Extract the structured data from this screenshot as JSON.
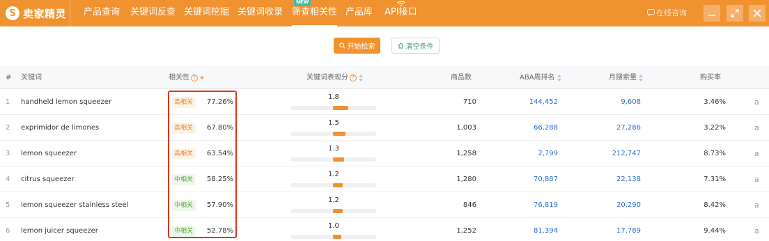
{
  "app": {
    "logo_mark": "S",
    "logo_text": "卖家精灵"
  },
  "nav": {
    "items": [
      "产品查询",
      "关键词反查",
      "关键词挖掘",
      "关键词收录",
      "筛查相关性",
      "产品库",
      "API接口"
    ],
    "active_index": 4,
    "badge": "NEW",
    "consult_label": "在线咨询"
  },
  "toolbar": {
    "search_label": "开始检索",
    "clear_label": "清空条件"
  },
  "table": {
    "columns": {
      "index": "#",
      "keyword": "关键词",
      "relevance": "相关性",
      "performance": "关键词表现分",
      "products": "商品数",
      "aba_rank": "ABA周排名",
      "monthly_searches": "月搜索量",
      "purchase_rate": "购买率"
    },
    "rows": [
      {
        "idx": "1",
        "keyword": "handheld lemon squeezer",
        "tag": "高相关",
        "level": "high",
        "relevance_pct": "77.26%",
        "score": "1.8",
        "products": "710",
        "aba_rank": "144,452",
        "monthly_searches": "9,608",
        "purchase_rate": "3.46%",
        "amazon_icon": "a"
      },
      {
        "idx": "2",
        "keyword": "exprimidor de limones",
        "tag": "高相关",
        "level": "high",
        "relevance_pct": "67.80%",
        "score": "1.5",
        "products": "1,003",
        "aba_rank": "66,288",
        "monthly_searches": "27,286",
        "purchase_rate": "3.22%",
        "amazon_icon": "a"
      },
      {
        "idx": "3",
        "keyword": "lemon squeezer",
        "tag": "高相关",
        "level": "high",
        "relevance_pct": "63.54%",
        "score": "1.3",
        "products": "1,258",
        "aba_rank": "2,799",
        "monthly_searches": "212,747",
        "purchase_rate": "8.73%",
        "amazon_icon": "a"
      },
      {
        "idx": "4",
        "keyword": "citrus squeezer",
        "tag": "中相关",
        "level": "mid",
        "relevance_pct": "58.25%",
        "score": "1.2",
        "products": "1,280",
        "aba_rank": "70,887",
        "monthly_searches": "22,138",
        "purchase_rate": "7.31%",
        "amazon_icon": "a"
      },
      {
        "idx": "5",
        "keyword": "lemon squeezer stainless steel",
        "tag": "中相关",
        "level": "mid",
        "relevance_pct": "57.90%",
        "score": "1.2",
        "products": "846",
        "aba_rank": "76,819",
        "monthly_searches": "20,290",
        "purchase_rate": "8.42%",
        "amazon_icon": "a"
      },
      {
        "idx": "6",
        "keyword": "lemon juicer squeezer",
        "tag": "中相关",
        "level": "mid",
        "relevance_pct": "52.78%",
        "score": "1.0",
        "products": "1,252",
        "aba_rank": "81,394",
        "monthly_searches": "17,789",
        "purchase_rate": "9.44%",
        "amazon_icon": "a"
      }
    ]
  },
  "colors": {
    "brand": "#f0922f",
    "link": "#2a6fcf",
    "high_tag": "#f0822f",
    "mid_tag": "#58a83a",
    "highlight": "#e0321f"
  },
  "icons": {
    "logo": "logo-icon",
    "api": "wifi-icon",
    "consult": "chat-icon",
    "minimize": "minimize-icon",
    "maximize": "expand-icon",
    "close": "close-icon",
    "search": "search-icon",
    "clear": "home-icon",
    "help": "help-icon",
    "sort": "sort-icon",
    "amazon": "amazon-icon"
  }
}
